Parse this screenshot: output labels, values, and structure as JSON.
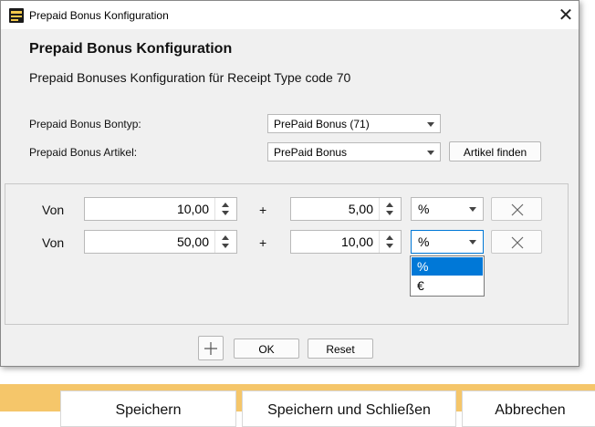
{
  "window": {
    "title": "Prepaid Bonus Konfiguration",
    "close_glyph": "✕"
  },
  "header": {
    "title": "Prepaid Bonus Konfiguration",
    "subtitle": "Prepaid Bonuses Konfiguration für Receipt Type code 70"
  },
  "form": {
    "bontyp_label": "Prepaid Bonus Bontyp:",
    "bontyp_value": "PrePaid Bonus (71)",
    "artikel_label": "Prepaid Bonus Artikel:",
    "artikel_value": "PrePaid Bonus",
    "find_button": "Artikel finden"
  },
  "rules": [
    {
      "from_label": "Von",
      "from_value": "10,00",
      "plus": "+",
      "bonus_value": "5,00",
      "unit": "%"
    },
    {
      "from_label": "Von",
      "from_value": "50,00",
      "plus": "+",
      "bonus_value": "10,00",
      "unit": "%"
    }
  ],
  "unit_dropdown": {
    "options": [
      "%",
      "€"
    ],
    "selected_index": 0
  },
  "footer": {
    "ok_label": "OK",
    "reset_label": "Reset"
  },
  "background_app": {
    "buttons": [
      "Speichern",
      "Speichern und Schließen",
      "Abbrechen"
    ],
    "accent_color": "#f5c66a"
  },
  "colors": {
    "selection": "#0078d7",
    "dialog_bg": "#f0f0f0"
  },
  "icons": {
    "app": "app-logo-icon",
    "close": "close-icon",
    "add": "plus-icon",
    "delete": "x-icon"
  }
}
